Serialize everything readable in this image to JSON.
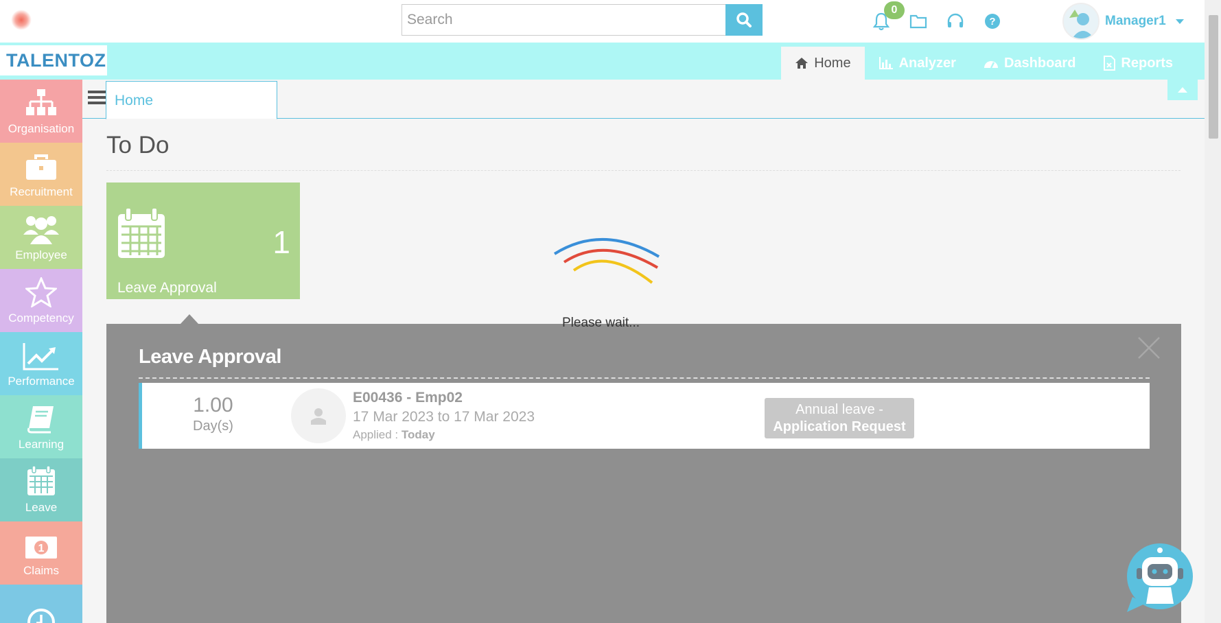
{
  "topbar": {
    "search_placeholder": "Search",
    "notification_count": "0",
    "user_name": "Manager1"
  },
  "navbar": {
    "brand": "TALENTOZ",
    "links": [
      {
        "label": "Home",
        "icon": "home-icon",
        "active": true
      },
      {
        "label": "Analyzer",
        "icon": "bar-chart-icon",
        "active": false
      },
      {
        "label": "Dashboard",
        "icon": "dashboard-icon",
        "active": false
      },
      {
        "label": "Reports",
        "icon": "report-file-icon",
        "active": false
      }
    ]
  },
  "sidebar": {
    "items": [
      {
        "label": "Organisation",
        "icon": "org-chart-icon",
        "color": "#f5a3a5"
      },
      {
        "label": "Recruitment",
        "icon": "briefcase-icon",
        "color": "#f3c68e"
      },
      {
        "label": "Employee",
        "icon": "users-icon",
        "color": "#b9da94"
      },
      {
        "label": "Competency",
        "icon": "star-icon",
        "color": "#d8b7ec"
      },
      {
        "label": "Performance",
        "icon": "trend-icon",
        "color": "#7cd5e6"
      },
      {
        "label": "Learning",
        "icon": "book-icon",
        "color": "#8ee0cf"
      },
      {
        "label": "Leave",
        "icon": "calendar-icon",
        "color": "#7dcec6"
      },
      {
        "label": "Claims",
        "icon": "money-icon",
        "color": "#f5a89a"
      },
      {
        "label": "",
        "icon": "clock-icon",
        "color": "#7cc8e4"
      }
    ]
  },
  "tabs": {
    "home_label": "Home"
  },
  "main": {
    "title": "To Do",
    "tile": {
      "label": "Leave Approval",
      "count": "1",
      "color": "#aed58e"
    },
    "loader_text": "Please wait...",
    "panel": {
      "title": "Leave Approval",
      "rows": [
        {
          "days_value": "1.00",
          "days_unit": "Day(s)",
          "employee": "E00436 - Emp02",
          "dates": "17 Mar 2023 to 17 Mar 2023",
          "applied_label": "Applied : ",
          "applied_value": "Today",
          "leave_type": "Annual leave -",
          "request_type": "Application Request"
        }
      ]
    }
  },
  "colors": {
    "accent": "#5bc0de",
    "navbar": "#aef7f5",
    "panel": "#8f8f8f"
  }
}
